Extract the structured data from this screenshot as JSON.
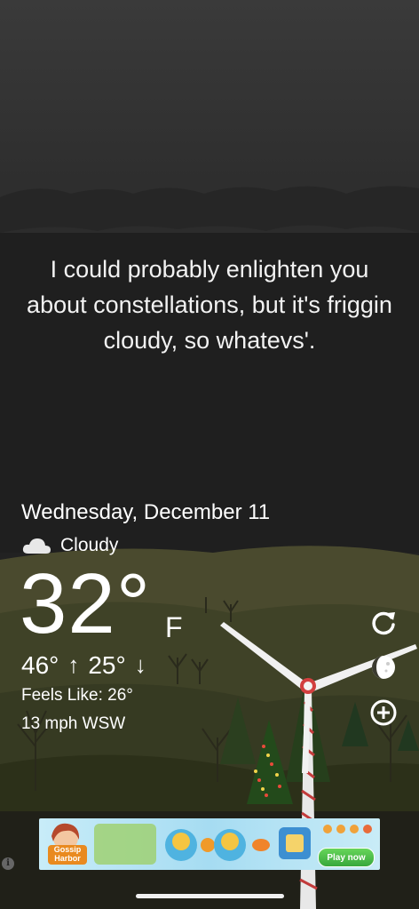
{
  "message": "I could probably enlighten you about constellations, but it's friggin cloudy, so whatevs'.",
  "weather": {
    "date": "Wednesday, December 11",
    "condition": "Cloudy",
    "condition_icon": "cloud-icon",
    "temperature": "32°",
    "unit": "F",
    "high": "46°",
    "low": "25°",
    "feels_like": "Feels Like: 26°",
    "wind": "13 mph WSW"
  },
  "actions": [
    {
      "name": "refresh-icon"
    },
    {
      "name": "moon-phase-icon"
    },
    {
      "name": "add-icon"
    }
  ],
  "ad": {
    "brand": "Gossip Harbor",
    "cta": "Play now"
  },
  "colors": {
    "sky_top": "#3a3a3a",
    "hill_color": "#4e4e2f",
    "ad_background": "#bfe7f6",
    "cta_green": "#4cbc46"
  }
}
